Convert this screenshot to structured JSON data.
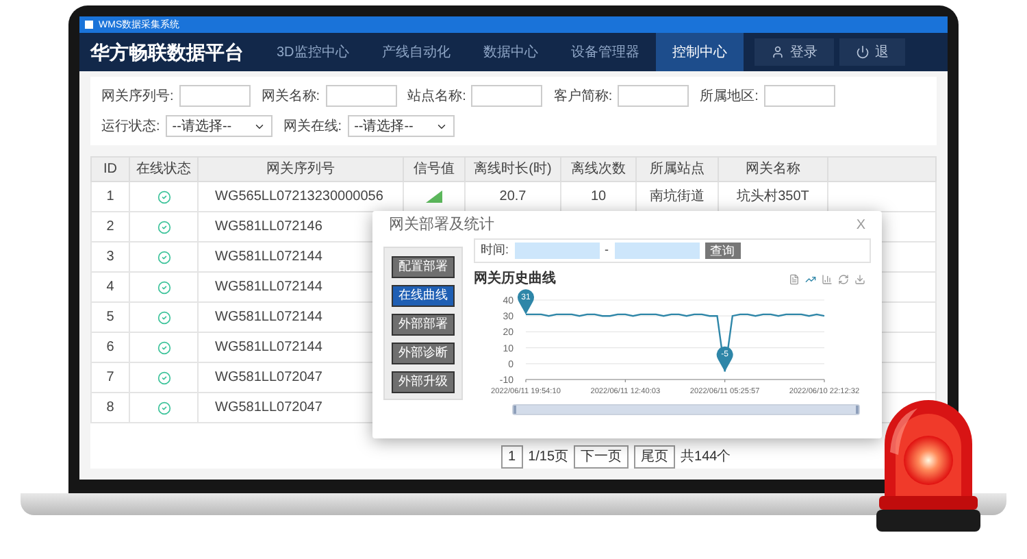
{
  "window": {
    "title": "WMS数据采集系统"
  },
  "header": {
    "brand": "华方畅联数据平台",
    "nav": [
      {
        "label": "3D监控中心",
        "selected": false
      },
      {
        "label": "产线自动化",
        "selected": false
      },
      {
        "label": "数据中心",
        "selected": false
      },
      {
        "label": "设备管理器",
        "selected": false
      },
      {
        "label": "控制中心",
        "selected": true
      }
    ],
    "actions": [
      {
        "label": "登录",
        "kind": "user"
      },
      {
        "label": "退",
        "kind": "power"
      }
    ]
  },
  "filters": [
    {
      "kind": "text",
      "label": "网关序列号:"
    },
    {
      "kind": "text",
      "label": "网关名称:"
    },
    {
      "kind": "text",
      "label": "站点名称:"
    },
    {
      "kind": "text",
      "label": "客户简称:"
    },
    {
      "kind": "text",
      "label": "所属地区:"
    },
    {
      "kind": "select",
      "label": "运行状态:",
      "value": "--请选择--"
    },
    {
      "kind": "select",
      "label": "网关在线:",
      "value": "--请选择--"
    }
  ],
  "table": {
    "columns": [
      "ID",
      "在线状态",
      "网关序列号",
      "信号值",
      "离线时长(时)",
      "离线次数",
      "所属站点",
      "网关名称"
    ],
    "rows": [
      {
        "kind": "full",
        "id": "1",
        "online": true,
        "serial": "WG565LL07213230000056",
        "offline_hours": "20.7",
        "offline_count": "10",
        "site": "南坑街道",
        "name": "坑头村350T"
      },
      {
        "kind": "covered",
        "id": "2",
        "online": true,
        "serial": "WG581LL072146"
      },
      {
        "kind": "covered",
        "id": "3",
        "online": true,
        "serial": "WG581LL072144"
      },
      {
        "kind": "covered",
        "id": "4",
        "online": true,
        "serial": "WG581LL072144"
      },
      {
        "kind": "covered",
        "id": "5",
        "online": true,
        "serial": "WG581LL072144"
      },
      {
        "kind": "covered",
        "id": "6",
        "online": true,
        "serial": "WG581LL072144"
      },
      {
        "kind": "covered",
        "id": "7",
        "online": true,
        "serial": "WG581LL072047"
      },
      {
        "kind": "covered",
        "id": "8",
        "online": true,
        "serial": "WG581LL072047"
      }
    ]
  },
  "dialog": {
    "title": "网关部署及统计",
    "close": "X",
    "menu": [
      {
        "label": "配置部署",
        "selected": false
      },
      {
        "label": "在线曲线",
        "selected": true
      },
      {
        "label": "外部部署",
        "selected": false
      },
      {
        "label": "外部诊断",
        "selected": false
      },
      {
        "label": "外部升级",
        "selected": false
      }
    ],
    "time_label": "时间:",
    "separator": "-",
    "query": "查询",
    "max_pin": "31",
    "min_pin": "-5",
    "zoom": {
      "level": 1
    },
    "chart_data": {
      "type": "line",
      "title": "网关历史曲线",
      "grid": true,
      "ylim": [
        -10,
        40
      ],
      "yticks": [
        -10,
        0,
        10,
        20,
        30,
        40
      ],
      "categories": [
        "2022/06/11 19:54:10",
        null,
        null,
        null,
        null,
        null,
        null,
        null,
        null,
        null,
        null,
        null,
        null,
        "2022/06/11 12:40:03",
        null,
        null,
        null,
        null,
        null,
        null,
        null,
        null,
        null,
        null,
        null,
        null,
        "2022/06/11 05:25:57",
        null,
        null,
        null,
        null,
        null,
        null,
        null,
        null,
        null,
        null,
        null,
        null,
        "2022/06/10 22:12:32"
      ],
      "series": [
        {
          "color": "#2e86a8",
          "values": [
            31,
            31,
            31,
            30,
            31,
            31,
            31,
            30,
            31,
            31,
            30,
            30,
            31,
            31,
            30,
            31,
            31,
            31,
            30,
            31,
            31,
            30,
            31,
            31,
            30,
            30,
            -5,
            30,
            31,
            31,
            30,
            31,
            31,
            30,
            31,
            31,
            31,
            30,
            31,
            30
          ]
        }
      ]
    }
  },
  "pagination": {
    "current": "1",
    "page_info": "1/15页",
    "next": "下一页",
    "last": "尾页",
    "total": "共144个"
  }
}
